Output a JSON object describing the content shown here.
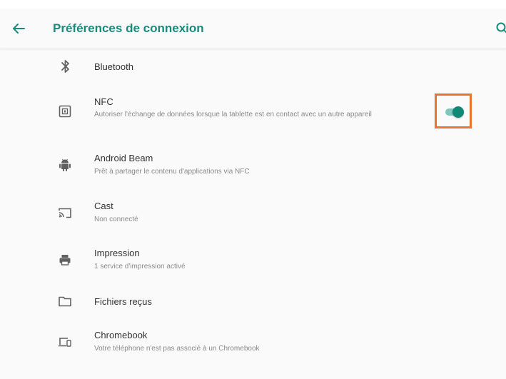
{
  "app_bar": {
    "title": "Préférences de connexion"
  },
  "icons": {
    "back": "arrow-left-icon",
    "search": "search-icon"
  },
  "colors": {
    "accent": "#1a8a7c",
    "toggle_thumb": "#118875",
    "toggle_track": "#7fc6bc",
    "highlight_frame": "#e8752f"
  },
  "items": [
    {
      "key": "bluetooth",
      "label": "Bluetooth",
      "icon": "bluetooth-icon"
    },
    {
      "key": "nfc",
      "label": "NFC",
      "subtitle": "Autoriser l'échange de données lorsque la tablette est en contact avec un autre appareil",
      "icon": "nfc-icon",
      "toggle_on": true
    },
    {
      "key": "android-beam",
      "label": "Android Beam",
      "subtitle": "Prêt à partager le contenu d'applications via NFC",
      "icon": "android-icon"
    },
    {
      "key": "cast",
      "label": "Cast",
      "subtitle": "Non connecté",
      "icon": "cast-icon"
    },
    {
      "key": "impression",
      "label": "Impression",
      "subtitle": "1 service d'impression activé",
      "icon": "printer-icon"
    },
    {
      "key": "fichiers",
      "label": "Fichiers reçus",
      "icon": "folder-icon"
    },
    {
      "key": "chromebook",
      "label": "Chromebook",
      "subtitle": "Votre téléphone n'est pas associé à un Chromebook",
      "icon": "chromebook-icon"
    }
  ]
}
